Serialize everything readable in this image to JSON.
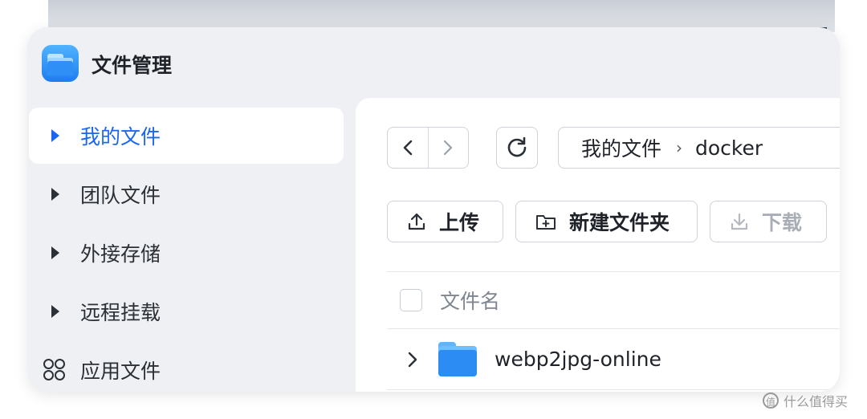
{
  "app": {
    "title": "文件管理",
    "icon": "folder-app-icon"
  },
  "sidebar": {
    "items": [
      {
        "label": "我的文件",
        "icon": "caret-right-icon",
        "active": true
      },
      {
        "label": "团队文件",
        "icon": "caret-right-icon",
        "active": false
      },
      {
        "label": "外接存储",
        "icon": "caret-right-icon",
        "active": false
      },
      {
        "label": "远程挂载",
        "icon": "caret-right-icon",
        "active": false
      },
      {
        "label": "应用文件",
        "icon": "apps-icon",
        "active": false
      }
    ]
  },
  "toolbar": {
    "path": {
      "root": "我的文件",
      "current": "docker"
    },
    "upload_label": "上传",
    "new_folder_label": "新建文件夹",
    "download_label": "下载"
  },
  "list": {
    "header": {
      "name_label": "文件名"
    },
    "rows": [
      {
        "name": "webp2jpg-online",
        "type": "folder"
      }
    ]
  },
  "watermark": {
    "text": "什么值得买",
    "icon": "zhi-icon"
  },
  "colors": {
    "accent": "#1a66f0",
    "folder": "#2c8cf4",
    "window_bg": "#eef0f4"
  }
}
